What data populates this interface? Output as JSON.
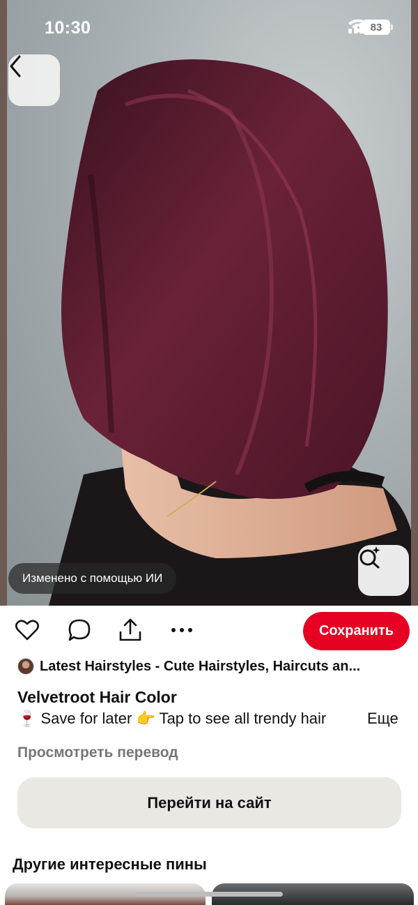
{
  "status_bar": {
    "time": "10:30",
    "battery": "83",
    "icons": [
      "cellular-signal-icon",
      "wifi-icon",
      "battery-icon"
    ]
  },
  "image": {
    "ai_badge": "Изменено с помощью ИИ",
    "icons": [
      "back-arrow-icon",
      "visual-search-icon"
    ]
  },
  "actions": {
    "icons": [
      "heart-icon",
      "comment-icon",
      "share-icon",
      "more-options-icon"
    ],
    "save_label": "Сохранить",
    "save_color": "#e60023"
  },
  "pin": {
    "source_name": "Latest Hairstyles - Cute Hairstyles, Haircuts an...",
    "title": "Velvetroot Hair Color",
    "description": "🍷 Save for later 👉 Tap to see all trendy hair",
    "more_label": "Еще",
    "translate_label": "Просмотреть перевод",
    "visit_label": "Перейти на сайт"
  },
  "more_pins": {
    "heading": "Другие интересные пины"
  }
}
